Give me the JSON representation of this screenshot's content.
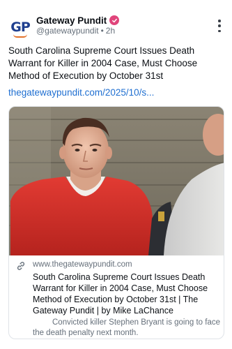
{
  "author": {
    "avatar_text": "GP",
    "display_name": "Gateway Pundit",
    "handle": "@gatewaypundit",
    "separator": "•",
    "time": "2h"
  },
  "post": {
    "text": "South Carolina Supreme Court Issues Death Warrant for Killer in 2004 Case, Must Choose Method of Execution by October 31st",
    "link": "thegatewaypundit.com/2025/10/s..."
  },
  "card": {
    "domain": "www.thegatewaypundit.com",
    "title": "South Carolina Supreme Court Issues Death Warrant for Killer in 2004 Case, Must Choose Method of Execution by October 31st | The Gateway Pundit | by Mike LaChance",
    "description": "Convicted killer Stephen Bryant is going to face the death penalty next month."
  },
  "icons": {
    "verified": "verified-badge-icon",
    "more": "more-vertical-icon",
    "link": "link-chain-icon"
  },
  "colors": {
    "verified_badge": "#e0457b",
    "link": "#1f6fd1",
    "brand_blue": "#1f3f8f",
    "brand_orange": "#e3722a",
    "shirt_red": "#d8322c"
  }
}
